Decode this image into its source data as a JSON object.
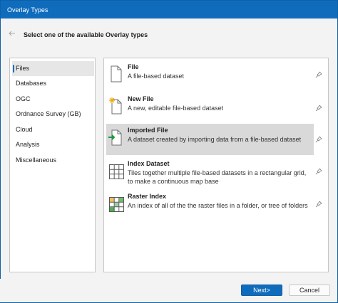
{
  "window": {
    "title": "Overlay Types"
  },
  "header": {
    "back_icon": "arrow-left-icon",
    "prompt": "Select one of the available Overlay types"
  },
  "categories": [
    {
      "label": "Files",
      "selected": true
    },
    {
      "label": "Databases",
      "selected": false
    },
    {
      "label": "OGC",
      "selected": false
    },
    {
      "label": "Ordnance Survey (GB)",
      "selected": false
    },
    {
      "label": "Cloud",
      "selected": false
    },
    {
      "label": "Analysis",
      "selected": false
    },
    {
      "label": "Miscellaneous",
      "selected": false
    }
  ],
  "overlay_types": [
    {
      "name": "File",
      "description": "A file-based dataset",
      "icon": "file-icon",
      "selected": false
    },
    {
      "name": "New File",
      "description": "A new, editable file-based dataset",
      "icon": "new-file-icon",
      "selected": false
    },
    {
      "name": "Imported File",
      "description": "A dataset created by importing data from a file-based dataset",
      "icon": "import-file-icon",
      "selected": true
    },
    {
      "name": "Index Dataset",
      "description": "Tiles together multiple file-based datasets in a rectangular grid, to make a continuous map base",
      "icon": "grid-icon",
      "selected": false
    },
    {
      "name": "Raster Index",
      "description": "An index of all of the the raster files in a folder, or tree of folders",
      "icon": "raster-grid-icon",
      "selected": false
    }
  ],
  "footer": {
    "next_label": "Next>",
    "cancel_label": "Cancel"
  },
  "colors": {
    "accent": "#0f6cbd",
    "selection": "#d9d9d9"
  }
}
